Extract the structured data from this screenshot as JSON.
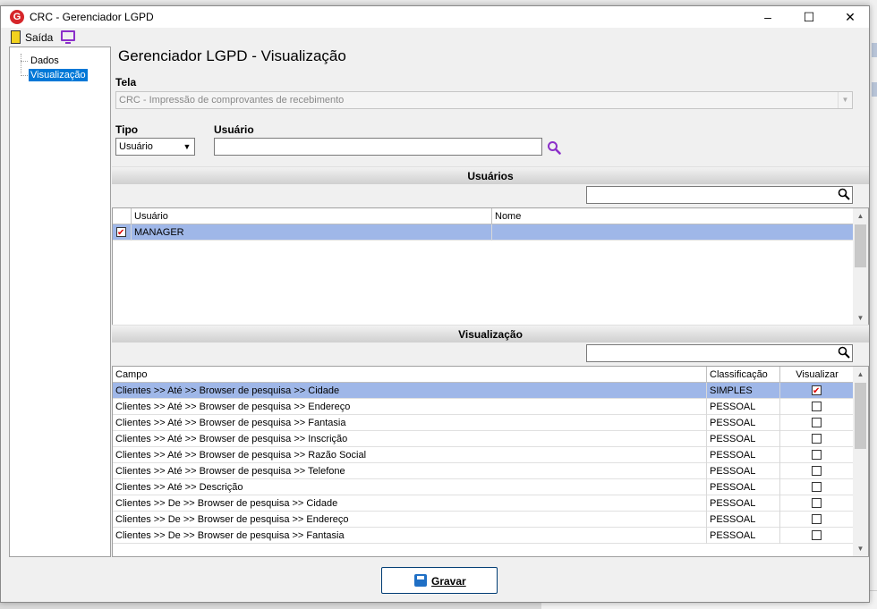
{
  "window": {
    "title": "CRC - Gerenciador LGPD",
    "logo_letter": "G",
    "minimize_glyph": "–",
    "maximize_glyph": "☐",
    "close_glyph": "✕"
  },
  "toolbar": {
    "exit_label": "Saída",
    "exit_icon": "exit-door-icon",
    "monitor_icon": "monitor-icon"
  },
  "tree": {
    "items": [
      {
        "label": "Dados"
      },
      {
        "label": "Visualização",
        "selected": true
      }
    ]
  },
  "page_title": "Gerenciador LGPD - Visualização",
  "form": {
    "tela_label": "Tela",
    "tela_value": "CRC - Impressão de comprovantes de recebimento",
    "tipo_label": "Tipo",
    "tipo_value": "Usuário",
    "usuario_label": "Usuário",
    "usuario_value": ""
  },
  "users_section": {
    "title": "Usuários",
    "search_value": "",
    "columns": [
      "Usuário",
      "Nome"
    ],
    "rows": [
      {
        "checked": true,
        "usuario": "MANAGER",
        "nome": ""
      }
    ]
  },
  "view_section": {
    "title": "Visualização",
    "search_value": "",
    "columns": [
      "Campo",
      "Classificação",
      "Visualizar"
    ],
    "rows": [
      {
        "campo": "Clientes >> Até >> Browser de pesquisa >> Cidade",
        "classificacao": "SIMPLES",
        "visualizar": true
      },
      {
        "campo": "Clientes >> Até >> Browser de pesquisa >> Endereço",
        "classificacao": "PESSOAL",
        "visualizar": false
      },
      {
        "campo": "Clientes >> Até >> Browser de pesquisa >> Fantasia",
        "classificacao": "PESSOAL",
        "visualizar": false
      },
      {
        "campo": "Clientes >> Até >> Browser de pesquisa >> Inscrição",
        "classificacao": "PESSOAL",
        "visualizar": false
      },
      {
        "campo": "Clientes >> Até >> Browser de pesquisa >> Razão Social",
        "classificacao": "PESSOAL",
        "visualizar": false
      },
      {
        "campo": "Clientes >> Até >> Browser de pesquisa >> Telefone",
        "classificacao": "PESSOAL",
        "visualizar": false
      },
      {
        "campo": "Clientes >> Até >> Descrição",
        "classificacao": "PESSOAL",
        "visualizar": false
      },
      {
        "campo": "Clientes >> De >> Browser de pesquisa >> Cidade",
        "classificacao": "PESSOAL",
        "visualizar": false
      },
      {
        "campo": "Clientes >> De >> Browser de pesquisa >> Endereço",
        "classificacao": "PESSOAL",
        "visualizar": false
      },
      {
        "campo": "Clientes >> De >> Browser de pesquisa >> Fantasia",
        "classificacao": "PESSOAL",
        "visualizar": false
      }
    ]
  },
  "save_button": {
    "label": "Gravar"
  },
  "colors": {
    "selection": "#9fb7e8",
    "tree_selection": "#0078d7",
    "accent_search": "#8b2fc9"
  }
}
